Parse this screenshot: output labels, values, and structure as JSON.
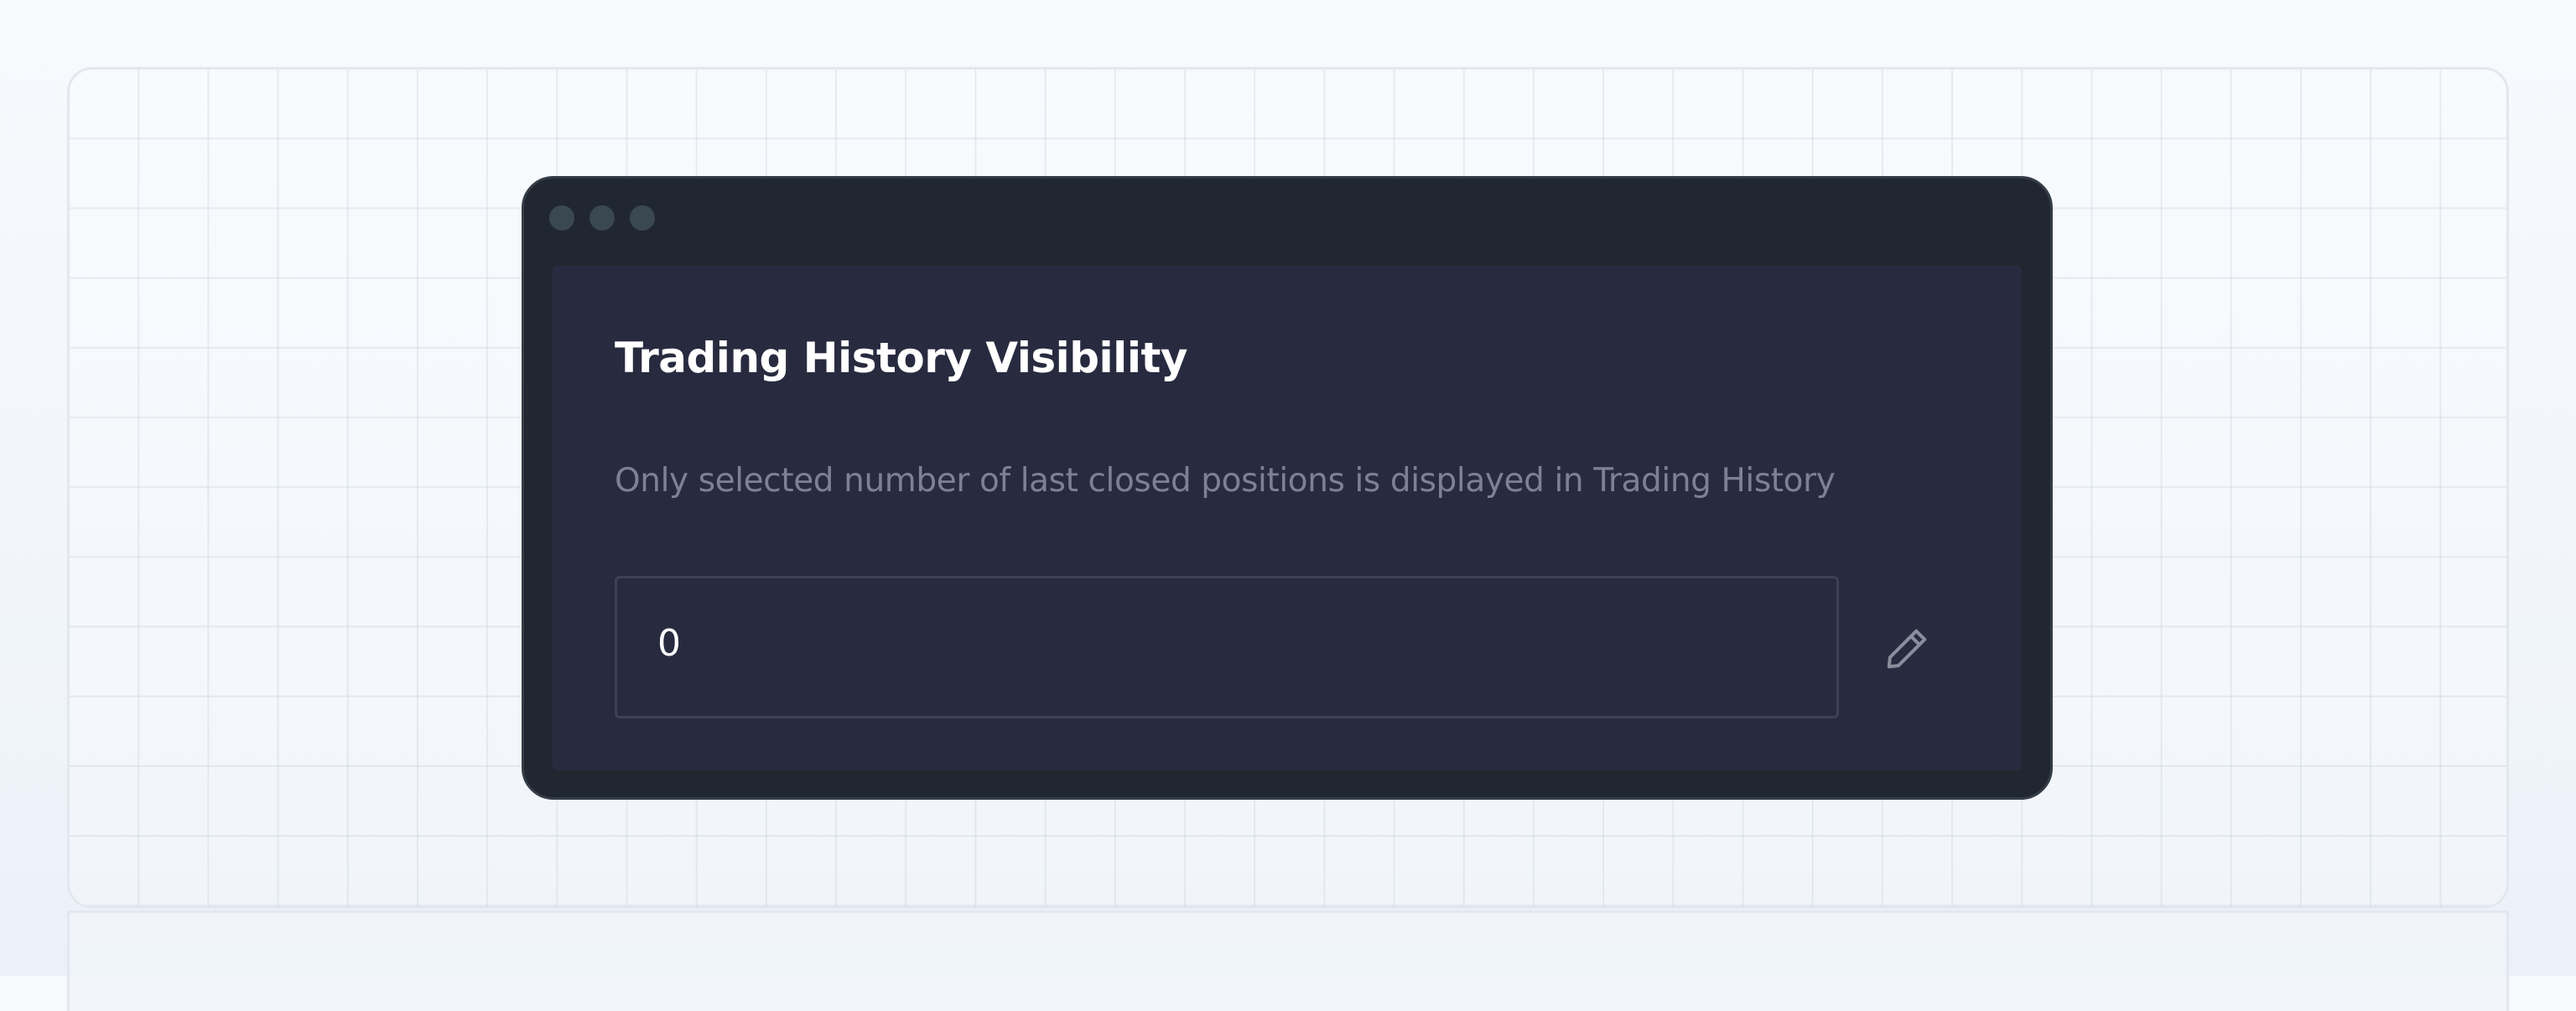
{
  "card": {
    "title": "Trading History Visibility",
    "description": "Only selected number of last closed positions is displayed in Trading History"
  },
  "input": {
    "value": "0"
  },
  "icons": {
    "edit": "pencil-icon"
  },
  "colors": {
    "window_frame": "#212730",
    "card_background": "#282b3f",
    "title_text": "#ffffff",
    "description_text": "#7e8195",
    "input_border": "#3d4158",
    "icon": "#8a8d9c"
  }
}
